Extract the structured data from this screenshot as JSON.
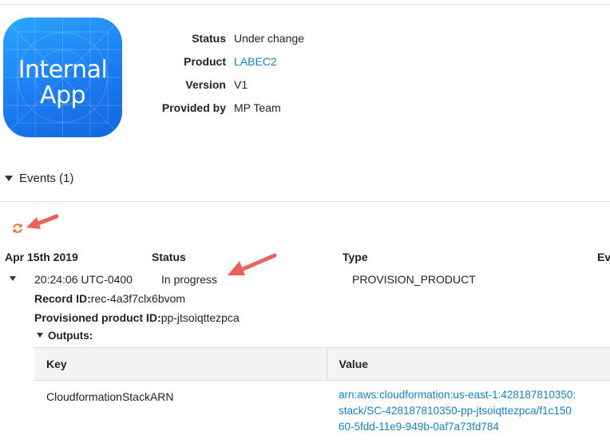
{
  "app_icon": {
    "line1": "Internal",
    "line2": "App"
  },
  "details": [
    {
      "label": "Status",
      "value": "Under change"
    },
    {
      "label": "Product",
      "value": "LABEC2"
    },
    {
      "label": "Version",
      "value": "V1"
    },
    {
      "label": "Provided by",
      "value": "MP Team"
    }
  ],
  "events": {
    "title": "Events (1)",
    "columns": {
      "date": "Apr 15th 2019",
      "status": "Status",
      "type": "Type",
      "extra": "Ev"
    },
    "row": {
      "time": "20:24:06 UTC-0400",
      "status": "In progress",
      "type": "PROVISION_PRODUCT"
    },
    "record_id_label": "Record ID:",
    "record_id_value": "rec-4a3f7clx6bvom",
    "pp_id_label": "Provisioned product ID:",
    "pp_id_value": "pp-jtsoiqttezpca",
    "outputs_label": "Outputs:",
    "outputs_table": {
      "key_header": "Key",
      "value_header": "Value",
      "row_key": "CloudformationStackARN",
      "row_value_lines": [
        "arn:aws:cloudformation:us-east-1:428187810350:",
        "stack/SC-428187810350-pp-jtsoiqttezpca/f1c150",
        "60-5fdd-11e9-949b-0af7a73fd784"
      ]
    }
  },
  "colors": {
    "link": "#1a7fc1",
    "annotation_arrow": "#e8615a",
    "refresh_icon": "#e8732a",
    "icon_gradient_top": "#2aa6ff",
    "icon_gradient_bottom": "#1466dd"
  },
  "icons": {
    "refresh": "refresh-icon",
    "caret": "caret-down-icon",
    "annotation": "arrow-annotation"
  }
}
